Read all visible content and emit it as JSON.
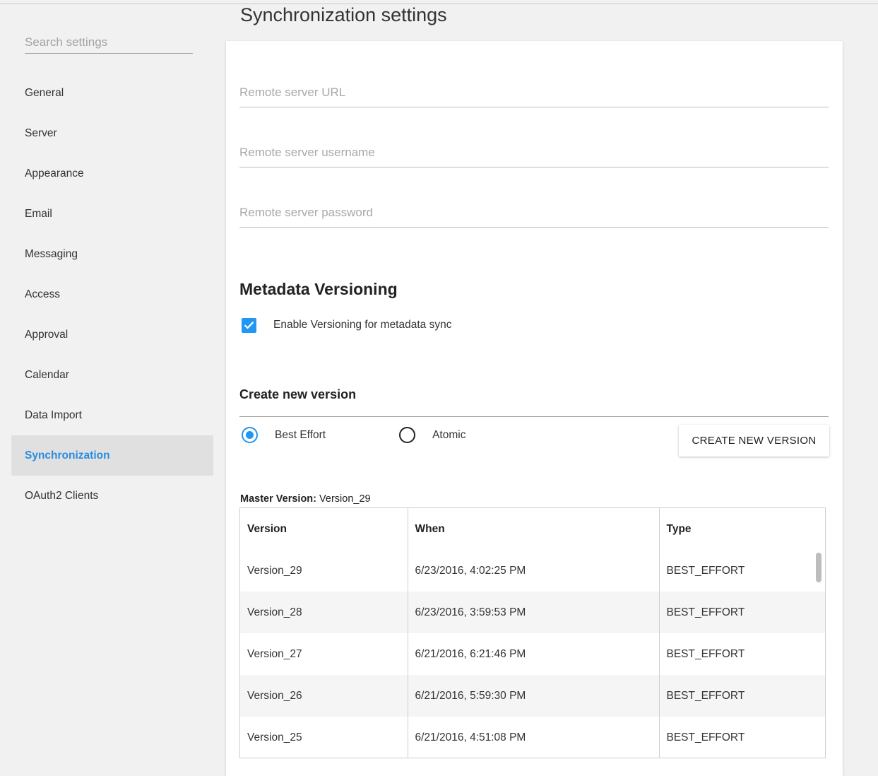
{
  "page": {
    "title": "Synchronization settings"
  },
  "sidebar": {
    "search_placeholder": "Search settings",
    "items": [
      {
        "label": "General"
      },
      {
        "label": "Server"
      },
      {
        "label": "Appearance"
      },
      {
        "label": "Email"
      },
      {
        "label": "Messaging"
      },
      {
        "label": "Access"
      },
      {
        "label": "Approval"
      },
      {
        "label": "Calendar"
      },
      {
        "label": "Data Import"
      },
      {
        "label": "Synchronization",
        "active": true
      },
      {
        "label": "OAuth2 Clients"
      }
    ]
  },
  "form": {
    "remote_url_placeholder": "Remote server URL",
    "remote_username_placeholder": "Remote server username",
    "remote_password_placeholder": "Remote server password",
    "remote_url_value": "",
    "remote_username_value": "",
    "remote_password_value": ""
  },
  "versioning": {
    "title": "Metadata Versioning",
    "checkbox_label": "Enable Versioning for metadata sync",
    "checkbox_checked": true,
    "create_title": "Create new version",
    "radio_options": [
      "Best Effort",
      "Atomic"
    ],
    "selected_option": "Best Effort",
    "create_button": "CREATE NEW VERSION",
    "master_label": "Master Version:",
    "master_value": "Version_29"
  },
  "table": {
    "headers": [
      "Version",
      "When",
      "Type"
    ],
    "rows": [
      [
        "Version_29",
        "6/23/2016, 4:02:25 PM",
        "BEST_EFFORT"
      ],
      [
        "Version_28",
        "6/23/2016, 3:59:53 PM",
        "BEST_EFFORT"
      ],
      [
        "Version_27",
        "6/21/2016, 6:21:46 PM",
        "BEST_EFFORT"
      ],
      [
        "Version_26",
        "6/21/2016, 5:59:30 PM",
        "BEST_EFFORT"
      ],
      [
        "Version_25",
        "6/21/2016, 4:51:08 PM",
        "BEST_EFFORT"
      ]
    ]
  },
  "colors": {
    "accent": "#2196f3",
    "active_nav_text": "#2a8be0",
    "active_nav_bg": "#e0e0e0",
    "page_bg": "#f1f1f1"
  }
}
